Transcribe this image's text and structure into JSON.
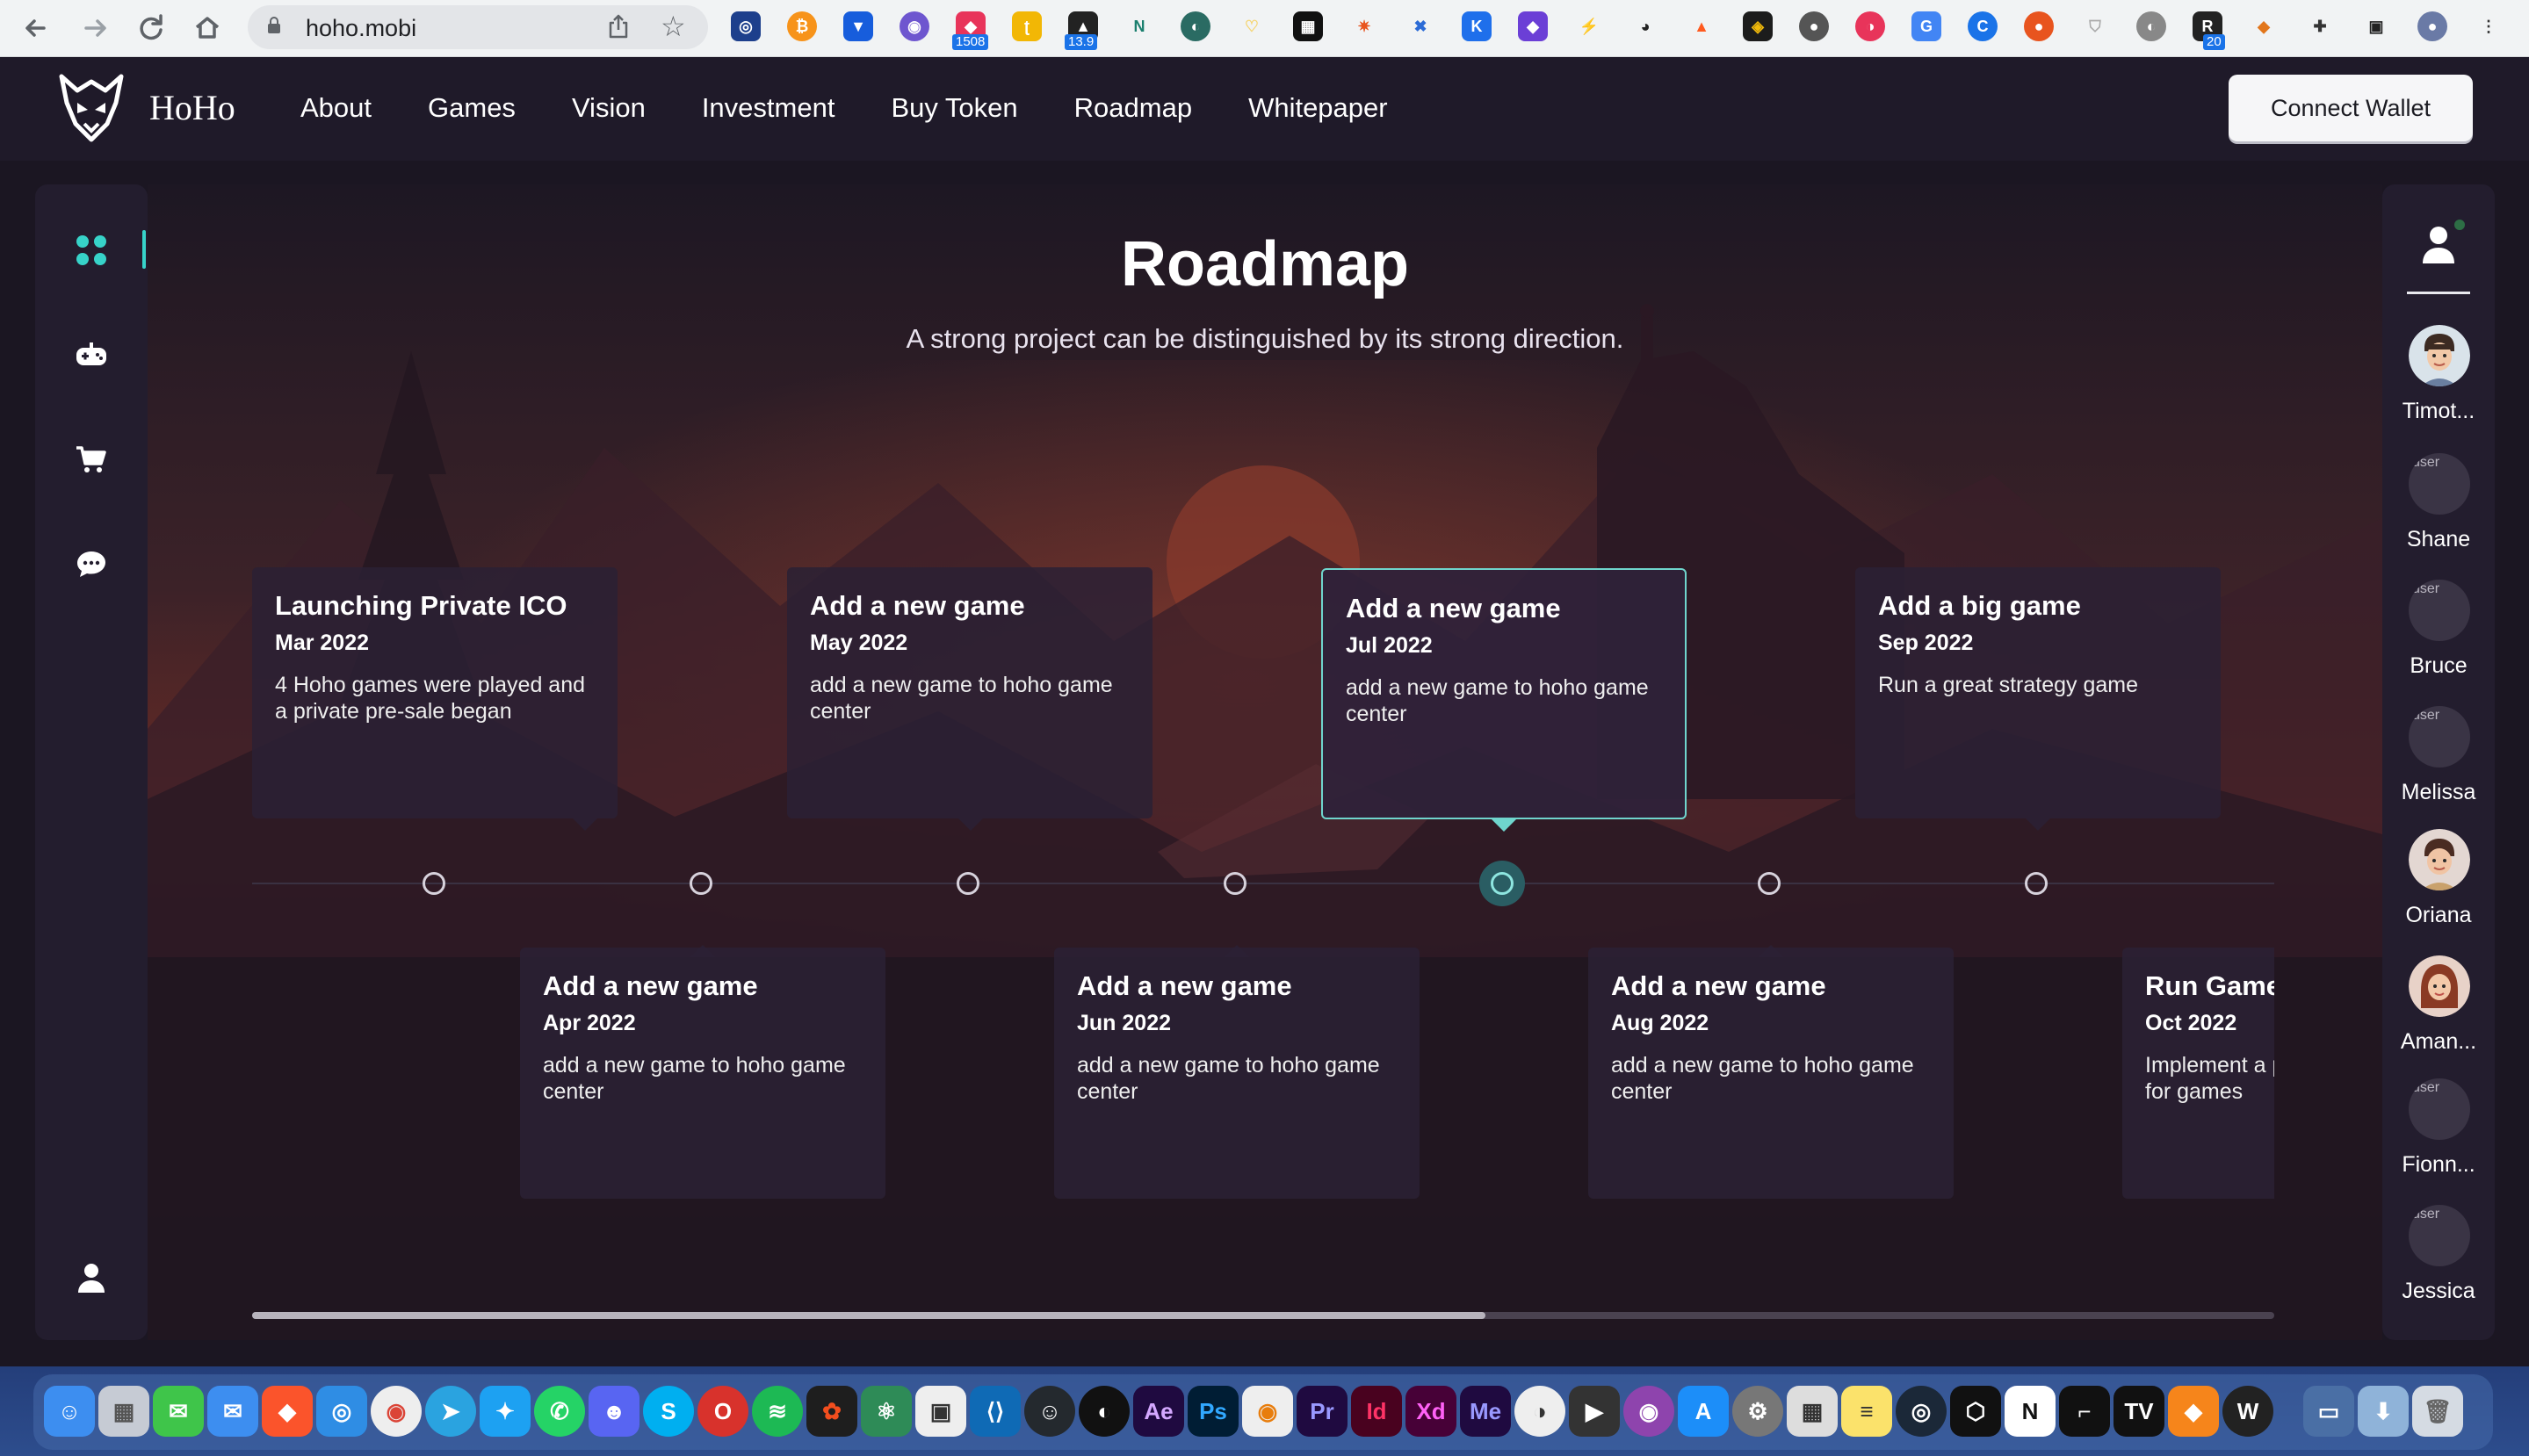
{
  "browser": {
    "url": "hoho.mobi",
    "back_icon": "arrow-left",
    "forward_icon": "arrow-right",
    "reload_icon": "reload",
    "home_icon": "home",
    "extension_badges": [
      "1508",
      "13.9",
      "20"
    ]
  },
  "header": {
    "brand": "HoHo",
    "nav": [
      "About",
      "Games",
      "Vision",
      "Investment",
      "Buy Token",
      "Roadmap",
      "Whitepaper"
    ],
    "connect_wallet": "Connect Wallet"
  },
  "roadmap": {
    "title": "Roadmap",
    "subtitle": "A strong project can be distinguished by its strong direction.",
    "active_index": 4,
    "milestones": [
      {
        "title": "Launching Private ICO",
        "date": "Mar 2022",
        "desc": [
          "4 Hoho games were played and",
          "a private pre-sale began"
        ]
      },
      {
        "title": "Add a new game",
        "date": "Apr 2022",
        "desc": [
          "add a new game to hoho game",
          "center"
        ]
      },
      {
        "title": "Add a new game",
        "date": "May 2022",
        "desc": [
          "add a new game to hoho game",
          "center"
        ]
      },
      {
        "title": "Add a new game",
        "date": "Jun 2022",
        "desc": [
          "add a new game to hoho game",
          "center"
        ]
      },
      {
        "title": "Add a new game",
        "date": "Jul 2022",
        "desc": [
          "add a new game to hoho game",
          "center"
        ]
      },
      {
        "title": "Add a new game",
        "date": "Aug 2022",
        "desc": [
          "add a new game to hoho game",
          "center"
        ]
      },
      {
        "title": "Add a big game",
        "date": "Sep 2022",
        "desc": [
          "Run a great strategy game",
          ""
        ]
      },
      {
        "title": "Run Game",
        "date": "Oct 2022",
        "desc": [
          "Implement a p",
          "for games"
        ]
      }
    ],
    "scroll_fraction": 0.61
  },
  "left_sidebar": {
    "items": [
      "dashboard-icon",
      "gamepad-icon",
      "cart-icon",
      "chat-icon"
    ],
    "bottom": "profile-icon"
  },
  "friends": {
    "broken_img_alt": "user",
    "list": [
      {
        "name": "Timot...",
        "avatar": "illustrated"
      },
      {
        "name": "Shane",
        "avatar": "broken"
      },
      {
        "name": "Bruce",
        "avatar": "broken"
      },
      {
        "name": "Melissa",
        "avatar": "broken"
      },
      {
        "name": "Oriana",
        "avatar": "illustrated"
      },
      {
        "name": "Aman...",
        "avatar": "illustrated-female"
      },
      {
        "name": "Fionn...",
        "avatar": "broken"
      },
      {
        "name": "Jessica",
        "avatar": "broken"
      }
    ]
  },
  "colors": {
    "accent": "#37d3c9",
    "panel": "#231d2e",
    "header": "#1f1a29"
  }
}
